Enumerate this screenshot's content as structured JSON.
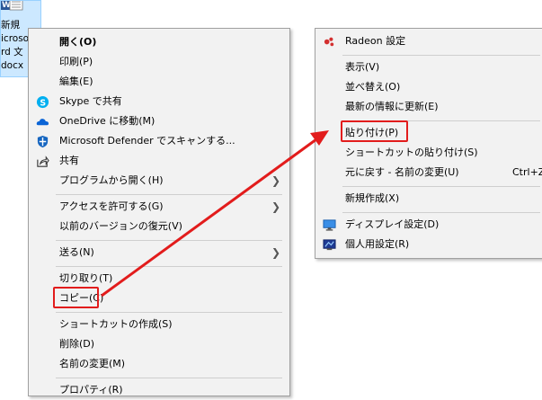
{
  "file": {
    "name_lines": [
      "新規",
      "icroso",
      "rd 文",
      "docx"
    ]
  },
  "context_menu": {
    "items": [
      {
        "label": "開く(O)",
        "bold": true
      },
      {
        "label": "印刷(P)"
      },
      {
        "label": "編集(E)"
      },
      {
        "label": "Skype で共有",
        "icon": "skype-icon"
      },
      {
        "label": "OneDrive に移動(M)",
        "icon": "onedrive-cloud-icon"
      },
      {
        "label": "Microsoft Defender でスキャンする...",
        "icon": "defender-shield-icon"
      },
      {
        "label": "共有",
        "icon": "share-icon"
      },
      {
        "label": "プログラムから開く(H)",
        "submenu": true
      },
      {
        "label": "アクセスを許可する(G)",
        "submenu": true
      },
      {
        "label": "以前のバージョンの復元(V)"
      },
      {
        "label": "送る(N)",
        "submenu": true
      },
      {
        "label": "切り取り(T)"
      },
      {
        "label": "コピー(C)"
      },
      {
        "label": "ショートカットの作成(S)"
      },
      {
        "label": "削除(D)"
      },
      {
        "label": "名前の変更(M)"
      },
      {
        "label": "プロパティ(R)"
      }
    ]
  },
  "desktop_menu": {
    "items": [
      {
        "label": "Radeon 設定",
        "icon": "radeon-icon"
      },
      {
        "label": "表示(V)"
      },
      {
        "label": "並べ替え(O)"
      },
      {
        "label": "最新の情報に更新(E)"
      },
      {
        "label": "貼り付け(P)"
      },
      {
        "label": "ショートカットの貼り付け(S)"
      },
      {
        "label": "元に戻す - 名前の変更(U)",
        "shortcut": "Ctrl+Z"
      },
      {
        "label": "新規作成(X)"
      },
      {
        "label": "ディスプレイ設定(D)",
        "icon": "display-icon"
      },
      {
        "label": "個人用設定(R)",
        "icon": "personalize-icon"
      }
    ]
  },
  "colors": {
    "annotation_red": "#e21c1c",
    "menu_bg": "#f2f2f2",
    "selection_bg": "#cce8ff"
  }
}
